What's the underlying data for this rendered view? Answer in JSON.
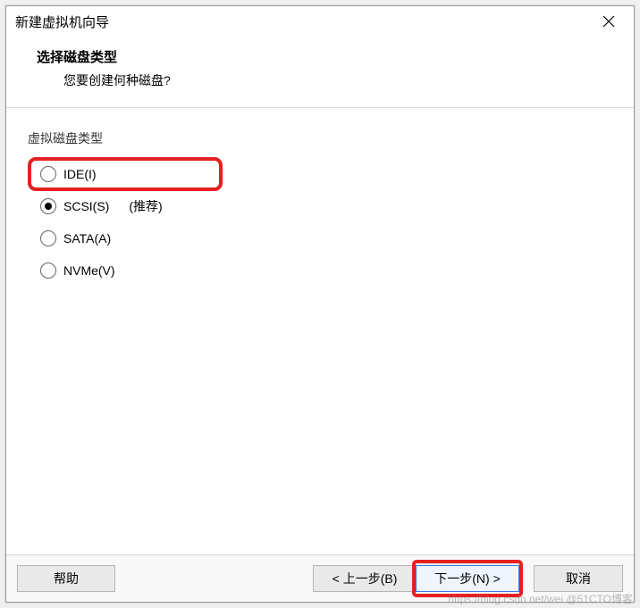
{
  "window": {
    "title": "新建虚拟机向导"
  },
  "header": {
    "title": "选择磁盘类型",
    "subtitle": "您要创建何种磁盘?"
  },
  "group": {
    "label": "虚拟磁盘类型",
    "options": {
      "ide": {
        "label": "IDE(I)"
      },
      "scsi": {
        "label": "SCSI(S)",
        "recommend": "(推荐)"
      },
      "sata": {
        "label": "SATA(A)"
      },
      "nvme": {
        "label": "NVMe(V)"
      }
    }
  },
  "footer": {
    "help": "帮助",
    "back": "< 上一步(B)",
    "next": "下一步(N) >",
    "cancel": "取消"
  },
  "watermark": "https://blog.csdn.net/wei @51CTO博客"
}
